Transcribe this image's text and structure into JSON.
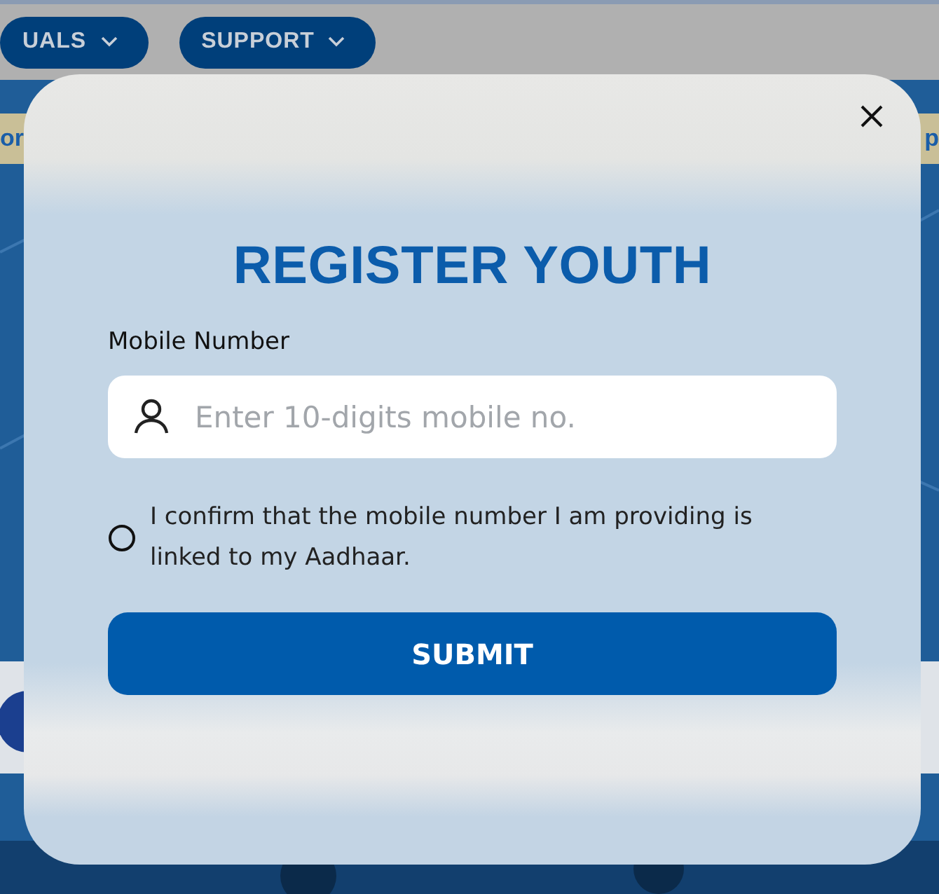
{
  "nav": [
    {
      "label": "UALS"
    },
    {
      "label": "SUPPORT"
    }
  ],
  "banner": {
    "left": "or",
    "right": "p"
  },
  "modal": {
    "title": "REGISTER YOUTH",
    "field": {
      "label": "Mobile Number",
      "placeholder": "Enter 10-digits mobile no."
    },
    "consent": {
      "text": "I confirm that the mobile number I am providing is linked to my Aadhaar.",
      "checked": false
    },
    "submit": "SUBMIT"
  }
}
